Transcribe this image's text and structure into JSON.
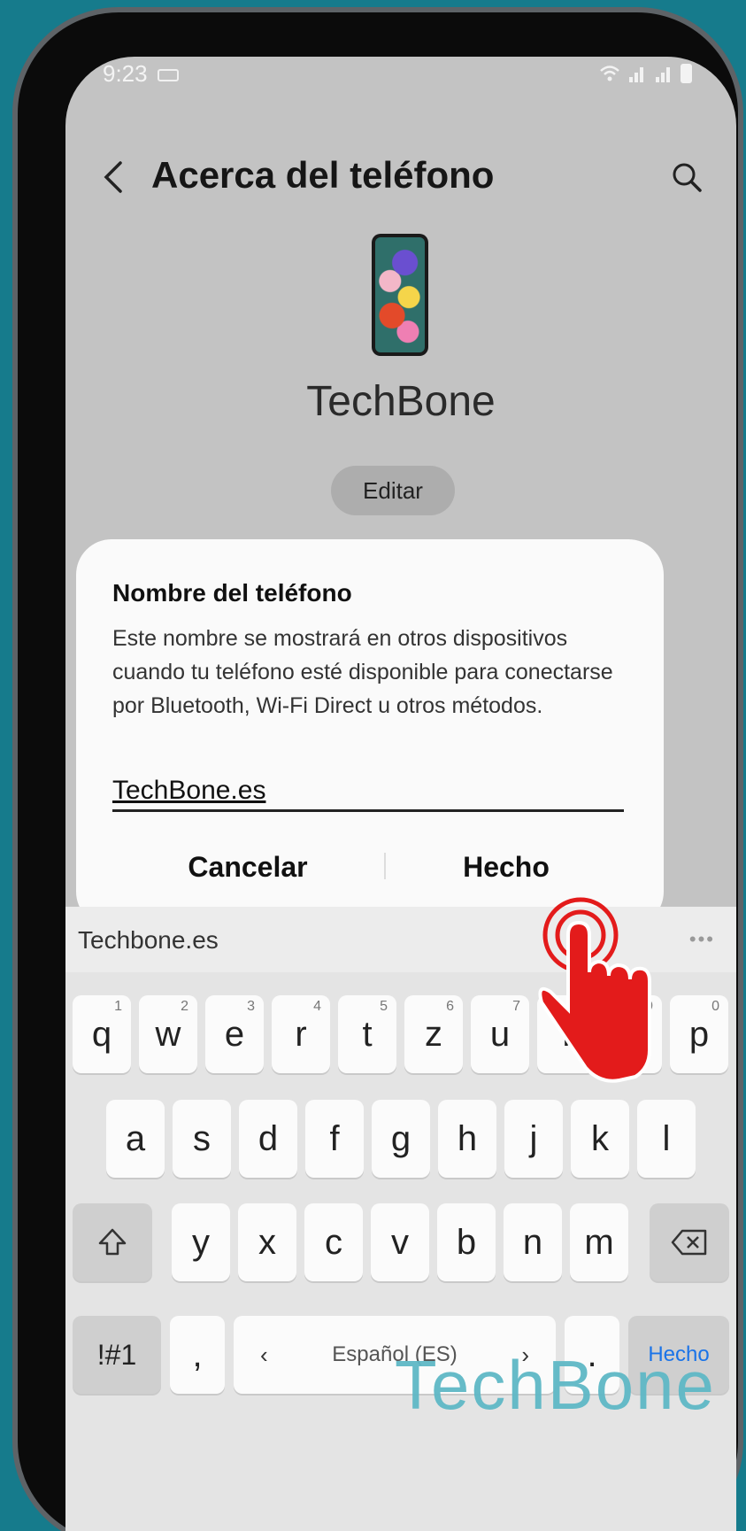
{
  "status_bar": {
    "time": "9:23"
  },
  "header": {
    "title": "Acerca del teléfono"
  },
  "device": {
    "name": "TechBone",
    "edit_label": "Editar"
  },
  "dialog": {
    "title": "Nombre del teléfono",
    "message": "Este nombre se mostrará en otros dispositivos cuando tu teléfono esté disponible para conectarse por Bluetooth, Wi-Fi Direct u otros métodos.",
    "input_value": "TechBone.es",
    "cancel_label": "Cancelar",
    "done_label": "Hecho"
  },
  "keyboard": {
    "suggestion": "Techbone.es",
    "row1": [
      {
        "k": "q",
        "n": "1"
      },
      {
        "k": "w",
        "n": "2"
      },
      {
        "k": "e",
        "n": "3"
      },
      {
        "k": "r",
        "n": "4"
      },
      {
        "k": "t",
        "n": "5"
      },
      {
        "k": "z",
        "n": "6"
      },
      {
        "k": "u",
        "n": "7"
      },
      {
        "k": "i",
        "n": "8"
      },
      {
        "k": "o",
        "n": "9"
      },
      {
        "k": "p",
        "n": "0"
      }
    ],
    "row2": [
      "a",
      "s",
      "d",
      "f",
      "g",
      "h",
      "j",
      "k",
      "l"
    ],
    "row3": [
      "y",
      "x",
      "c",
      "v",
      "b",
      "n",
      "m"
    ],
    "symbols_label": "!#1",
    "comma_label": ",",
    "space_label": "Español (ES)",
    "period_label": ".",
    "done_label": "Hecho"
  },
  "watermark": "TechBone",
  "colors": {
    "background": "#167b8c",
    "accent": "#1a73e8",
    "touch_indicator": "#e31b1b"
  }
}
